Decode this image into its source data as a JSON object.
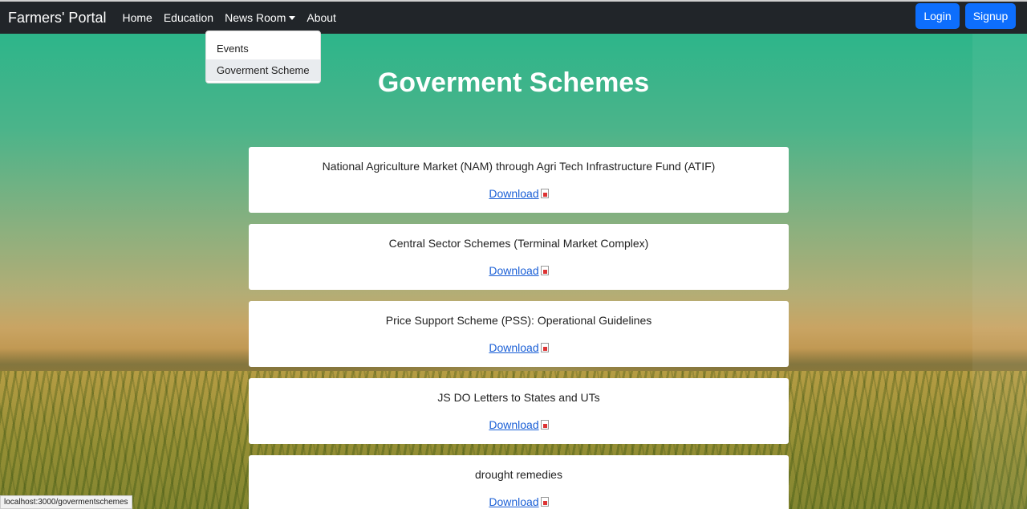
{
  "navbar": {
    "brand": "Farmers' Portal",
    "links": [
      "Home",
      "Education",
      "News Room",
      "About"
    ],
    "login_label": "Login",
    "signup_label": "Signup"
  },
  "dropdown": {
    "items": [
      "Events",
      "Goverment Scheme"
    ],
    "active_index": 1
  },
  "page": {
    "title": "Goverment Schemes"
  },
  "schemes": [
    {
      "title": "National Agriculture Market (NAM) through Agri Tech Infrastructure Fund (ATIF)",
      "link_label": "Download",
      "icon": "pdf-icon"
    },
    {
      "title": "Central Sector Schemes (Terminal Market Complex)",
      "link_label": "Download",
      "icon": "pdf-icon"
    },
    {
      "title": "Price Support Scheme (PSS): Operational Guidelines",
      "link_label": "Download",
      "icon": "pdf-icon"
    },
    {
      "title": "JS DO Letters to States and UTs",
      "link_label": "Download",
      "icon": "pdf-icon"
    },
    {
      "title": "drought remedies",
      "link_label": "Download",
      "icon": "pdf-icon"
    }
  ],
  "status_bar": {
    "url": "localhost:3000/govermentschemes"
  },
  "colors": {
    "navbar_bg": "#212529",
    "button_bg": "#0d6efd",
    "link_color": "#1a5fd6"
  }
}
